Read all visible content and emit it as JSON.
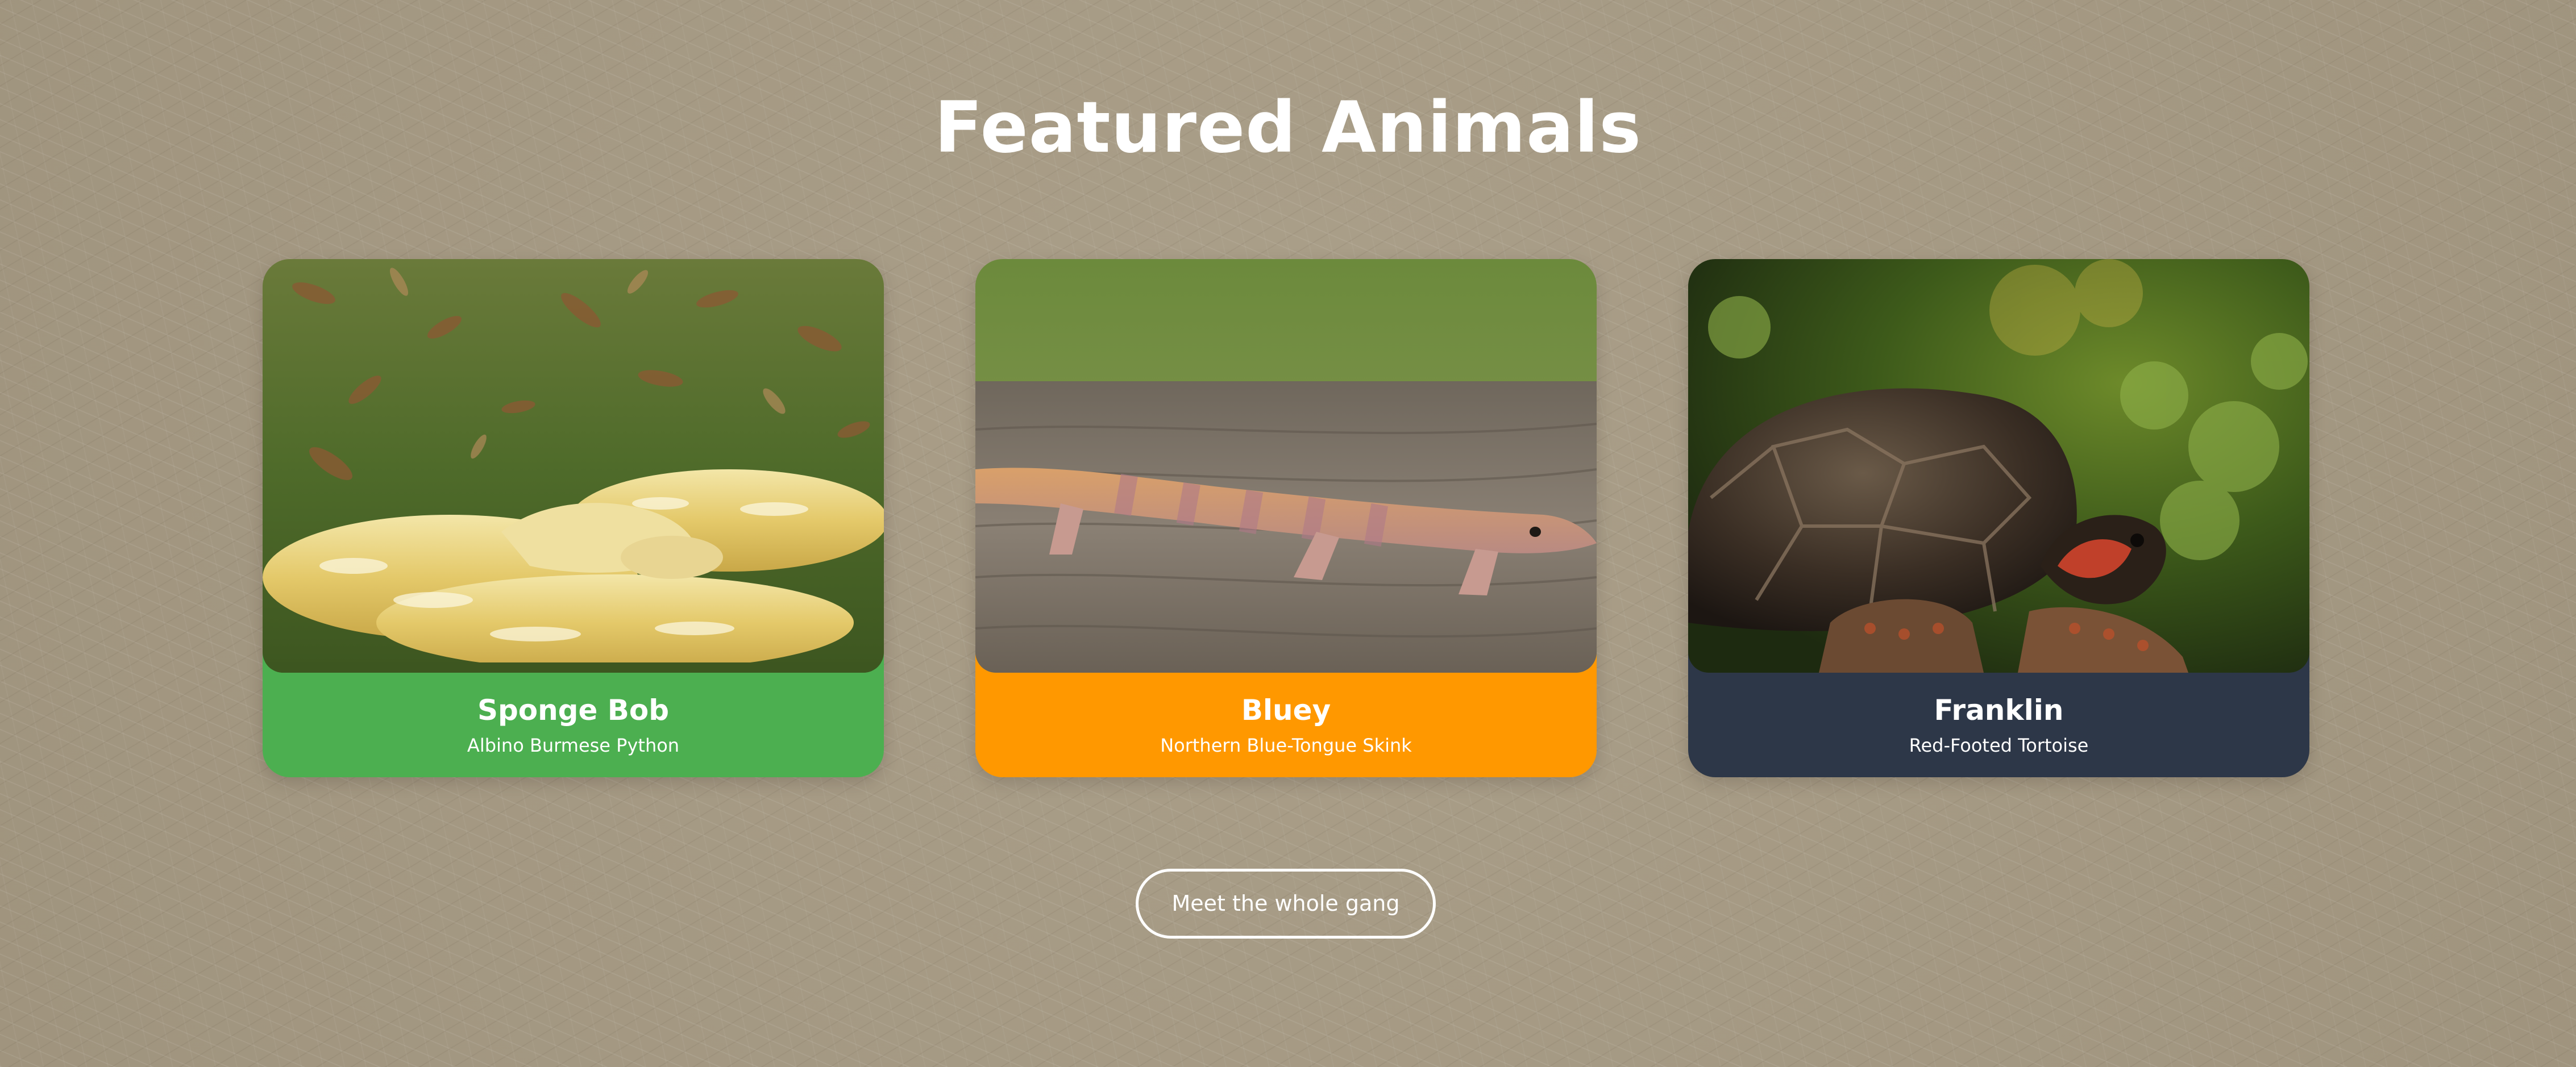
{
  "section": {
    "title": "Featured Animals"
  },
  "colors": {
    "background": "#a69a83",
    "snake_card": "#4caf50",
    "skink_card": "#ff9800",
    "tortoise_card": "#2d3748"
  },
  "animals": [
    {
      "name": "Sponge Bob",
      "species": "Albino Burmese Python",
      "accent": "#4caf50"
    },
    {
      "name": "Bluey",
      "species": "Northern Blue-Tongue Skink",
      "accent": "#ff9800"
    },
    {
      "name": "Franklin",
      "species": "Red-Footed Tortoise",
      "accent": "#2d3748"
    }
  ],
  "cta": {
    "label": "Meet the whole gang"
  }
}
